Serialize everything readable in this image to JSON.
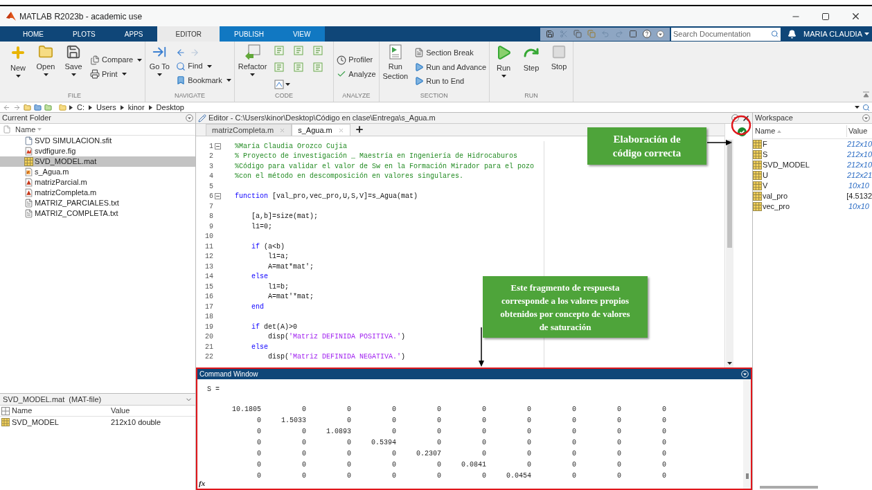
{
  "window": {
    "title": "MATLAB R2023b - academic use"
  },
  "ribbon_tabs": [
    {
      "label": "HOME",
      "selected": false,
      "contextual": false
    },
    {
      "label": "PLOTS",
      "selected": false,
      "contextual": false
    },
    {
      "label": "APPS",
      "selected": false,
      "contextual": false
    },
    {
      "label": "EDITOR",
      "selected": true,
      "contextual": true
    },
    {
      "label": "PUBLISH",
      "selected": false,
      "contextual": true
    },
    {
      "label": "VIEW",
      "selected": false,
      "contextual": true
    }
  ],
  "search": {
    "placeholder": "Search Documentation"
  },
  "user": "MARIA CLAUDIA",
  "ribbon_sections": [
    {
      "title": "FILE",
      "items": [
        {
          "kind": "large",
          "label": "New",
          "menu": true
        },
        {
          "kind": "large",
          "label": "Open",
          "menu": true
        },
        {
          "kind": "large",
          "label": "Save",
          "menu": true
        },
        {
          "kind": "small_stack",
          "entries": [
            {
              "label": "Compare",
              "menu": true
            },
            {
              "label": "Print",
              "menu": true
            }
          ]
        }
      ]
    },
    {
      "title": "NAVIGATE",
      "items": [
        {
          "kind": "large",
          "label": "Go To",
          "menu": true
        },
        {
          "kind": "small_stack",
          "entries": [
            {
              "kind": "arrows"
            },
            {
              "label": "Find",
              "menu": true
            },
            {
              "label": "Bookmark",
              "menu": true
            }
          ]
        }
      ]
    },
    {
      "title": "CODE",
      "items": [
        {
          "kind": "large",
          "label": "Refactor",
          "menu": true
        },
        {
          "kind": "icon_grid"
        }
      ]
    },
    {
      "title": "ANALYZE",
      "items": [
        {
          "kind": "small_stack",
          "entries": [
            {
              "label": "Profiler",
              "menu": false
            },
            {
              "label": "Analyze",
              "menu": false
            }
          ]
        }
      ]
    },
    {
      "title": "SECTION",
      "items": [
        {
          "kind": "large",
          "label": "Run Section",
          "menu": false
        },
        {
          "kind": "small_stack",
          "entries": [
            {
              "label": "Section Break",
              "menu": false
            },
            {
              "label": "Run and Advance",
              "menu": false
            },
            {
              "label": "Run to End",
              "menu": false
            }
          ]
        }
      ]
    },
    {
      "title": "RUN",
      "items": [
        {
          "kind": "large",
          "label": "Run",
          "menu": true
        },
        {
          "kind": "large",
          "label": "Step",
          "menu": false
        },
        {
          "kind": "large",
          "label": "Stop",
          "menu": false
        }
      ]
    }
  ],
  "path": [
    "C:",
    "Users",
    "kinor",
    "Desktop"
  ],
  "current_folder": {
    "title": "Current Folder",
    "column": "Name",
    "files": [
      {
        "name": "SVD SIMULACION.sfit",
        "kind": "doc",
        "selected": false
      },
      {
        "name": "svdfigure.fig",
        "kind": "figure",
        "selected": false
      },
      {
        "name": "SVD_MODEL.mat",
        "kind": "mat",
        "selected": true
      },
      {
        "name": "s_Agua.m",
        "kind": "function",
        "selected": false
      },
      {
        "name": "matrizParcial.m",
        "kind": "script",
        "selected": false
      },
      {
        "name": "matrizCompleta.m",
        "kind": "script",
        "selected": false
      },
      {
        "name": "MATRIZ_PARCIALES.txt",
        "kind": "text",
        "selected": false
      },
      {
        "name": "MATRIZ_COMPLETA.txt",
        "kind": "text",
        "selected": false
      }
    ]
  },
  "details": {
    "title": "SVD_MODEL.mat  (MAT-file)",
    "columns": [
      "Name",
      "Value"
    ],
    "rows": [
      {
        "name": "SVD_MODEL",
        "value": "212x10 double"
      }
    ]
  },
  "editor": {
    "title": "Editor - C:\\Users\\kinor\\Desktop\\Código en clase\\Entrega\\s_Agua.m",
    "tabs": [
      {
        "label": "matrizCompleta.m",
        "selected": false
      },
      {
        "label": "s_Agua.m",
        "selected": true
      }
    ],
    "lines": [
      {
        "number": "1",
        "fold": true,
        "segments": [
          {
            "kind": "comment",
            "text": "%María Claudia Orozco Cujia"
          }
        ]
      },
      {
        "number": "2",
        "segments": [
          {
            "kind": "comment",
            "text": "% Proyecto de investigación _ Maestría en Ingeniería de Hidrocaburos"
          }
        ]
      },
      {
        "number": "3",
        "segments": [
          {
            "kind": "comment",
            "text": "%Código para validar el valor de Sw en la Formación Mirador para el pozo"
          }
        ]
      },
      {
        "number": "4",
        "segments": [
          {
            "kind": "comment",
            "text": "%con el método en descomposición en valores singulares."
          }
        ]
      },
      {
        "number": "5"
      },
      {
        "number": "6",
        "fold": true,
        "segments": [
          {
            "kind": "keyword",
            "text": "function"
          },
          {
            "kind": "plain",
            "text": " [val_pro,vec_pro,U,S,V]=s_Agua(mat)"
          }
        ]
      },
      {
        "number": "7"
      },
      {
        "number": "8",
        "segments": [
          {
            "kind": "plain",
            "text": "    [a,b]=size(mat);"
          }
        ]
      },
      {
        "number": "9",
        "segments": [
          {
            "kind": "plain",
            "text": "    l1=0;"
          }
        ]
      },
      {
        "number": "10"
      },
      {
        "number": "11",
        "segments": [
          {
            "kind": "keyword",
            "text": "    if"
          },
          {
            "kind": "plain",
            "text": " (a<b)"
          }
        ]
      },
      {
        "number": "12",
        "segments": [
          {
            "kind": "plain",
            "text": "        l1=a;"
          }
        ]
      },
      {
        "number": "13",
        "segments": [
          {
            "kind": "plain",
            "text": "        A=mat*mat';"
          }
        ]
      },
      {
        "number": "14",
        "segments": [
          {
            "kind": "keyword",
            "text": "    else"
          }
        ]
      },
      {
        "number": "15",
        "segments": [
          {
            "kind": "plain",
            "text": "        l1=b;"
          }
        ]
      },
      {
        "number": "16",
        "segments": [
          {
            "kind": "plain",
            "text": "        A=mat'*mat;"
          }
        ]
      },
      {
        "number": "17",
        "segments": [
          {
            "kind": "keyword",
            "text": "    end"
          }
        ]
      },
      {
        "number": "18"
      },
      {
        "number": "19",
        "segments": [
          {
            "kind": "keyword",
            "text": "    if"
          },
          {
            "kind": "plain",
            "text": " det(A)>0"
          }
        ]
      },
      {
        "number": "20",
        "segments": [
          {
            "kind": "plain",
            "text": "        disp("
          },
          {
            "kind": "string",
            "text": "'Matriz DEFINIDA POSITIVA.'"
          },
          {
            "kind": "plain",
            "text": ")"
          }
        ]
      },
      {
        "number": "21",
        "segments": [
          {
            "kind": "keyword",
            "text": "    else"
          }
        ]
      },
      {
        "number": "22",
        "segments": [
          {
            "kind": "plain",
            "text": "        disp("
          },
          {
            "kind": "string",
            "text": "'Matriz DEFINIDA NEGATIVA.'"
          },
          {
            "kind": "plain",
            "text": ")"
          }
        ]
      }
    ]
  },
  "workspace": {
    "title": "Workspace",
    "columns": [
      "Name",
      "Value"
    ],
    "rows": [
      {
        "name": "F",
        "value": "212x10",
        "kind": "size"
      },
      {
        "name": "S",
        "value": "212x10",
        "kind": "size"
      },
      {
        "name": "SVD_MODEL",
        "value": "212x10",
        "kind": "size"
      },
      {
        "name": "U",
        "value": "212x21",
        "kind": "size"
      },
      {
        "name": "V",
        "value": "10x10",
        "kind": "size"
      },
      {
        "name": "val_pro",
        "value": "[4.5132",
        "kind": "value"
      },
      {
        "name": "vec_pro",
        "value": "10x10",
        "kind": "size"
      }
    ]
  },
  "command_window": {
    "title": "Command Window",
    "prompt": "fx",
    "output": "S =",
    "matrix": [
      [
        "10.1805",
        "0",
        "0",
        "0",
        "0",
        "0",
        "0",
        "0",
        "0",
        "0"
      ],
      [
        "0",
        "1.5033",
        "0",
        "0",
        "0",
        "0",
        "0",
        "0",
        "0",
        "0"
      ],
      [
        "0",
        "0",
        "1.0893",
        "0",
        "0",
        "0",
        "0",
        "0",
        "0",
        "0"
      ],
      [
        "0",
        "0",
        "0",
        "0.5394",
        "0",
        "0",
        "0",
        "0",
        "0",
        "0"
      ],
      [
        "0",
        "0",
        "0",
        "0",
        "0.2307",
        "0",
        "0",
        "0",
        "0",
        "0"
      ],
      [
        "0",
        "0",
        "0",
        "0",
        "0",
        "0.0841",
        "0",
        "0",
        "0",
        "0"
      ],
      [
        "0",
        "0",
        "0",
        "0",
        "0",
        "0",
        "0.0454",
        "0",
        "0",
        "0"
      ]
    ]
  },
  "annotations": [
    {
      "kind": "callout",
      "text": "Elaboración de código correcta"
    },
    {
      "kind": "callout",
      "text": "Este fragmento de respuesta corresponde a los valores propios obtenidos por concepto de valores de saturación"
    }
  ]
}
